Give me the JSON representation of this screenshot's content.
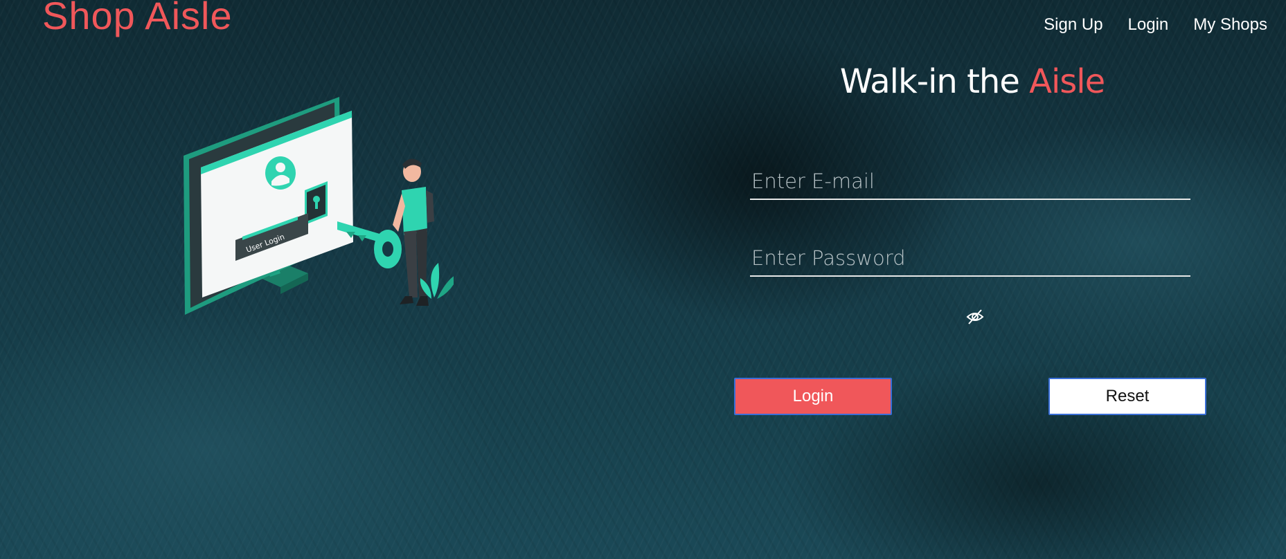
{
  "header": {
    "brand": "Shop Aisle",
    "nav": [
      {
        "label": "Sign Up"
      },
      {
        "label": "Login"
      },
      {
        "label": "My Shops"
      }
    ]
  },
  "hero": {
    "title_part1": "Walk-in the ",
    "title_accent": "Aisle",
    "illustration_label": "User Login"
  },
  "form": {
    "email_placeholder": "Enter E-mail",
    "email_value": "",
    "password_placeholder": "Enter Password",
    "password_value": "",
    "toggle_icon": "eye-slash-icon",
    "login_label": "Login",
    "reset_label": "Reset"
  },
  "colors": {
    "accent": "#f0575a",
    "illustration_teal": "#2fd4b0",
    "background": "#153844"
  }
}
